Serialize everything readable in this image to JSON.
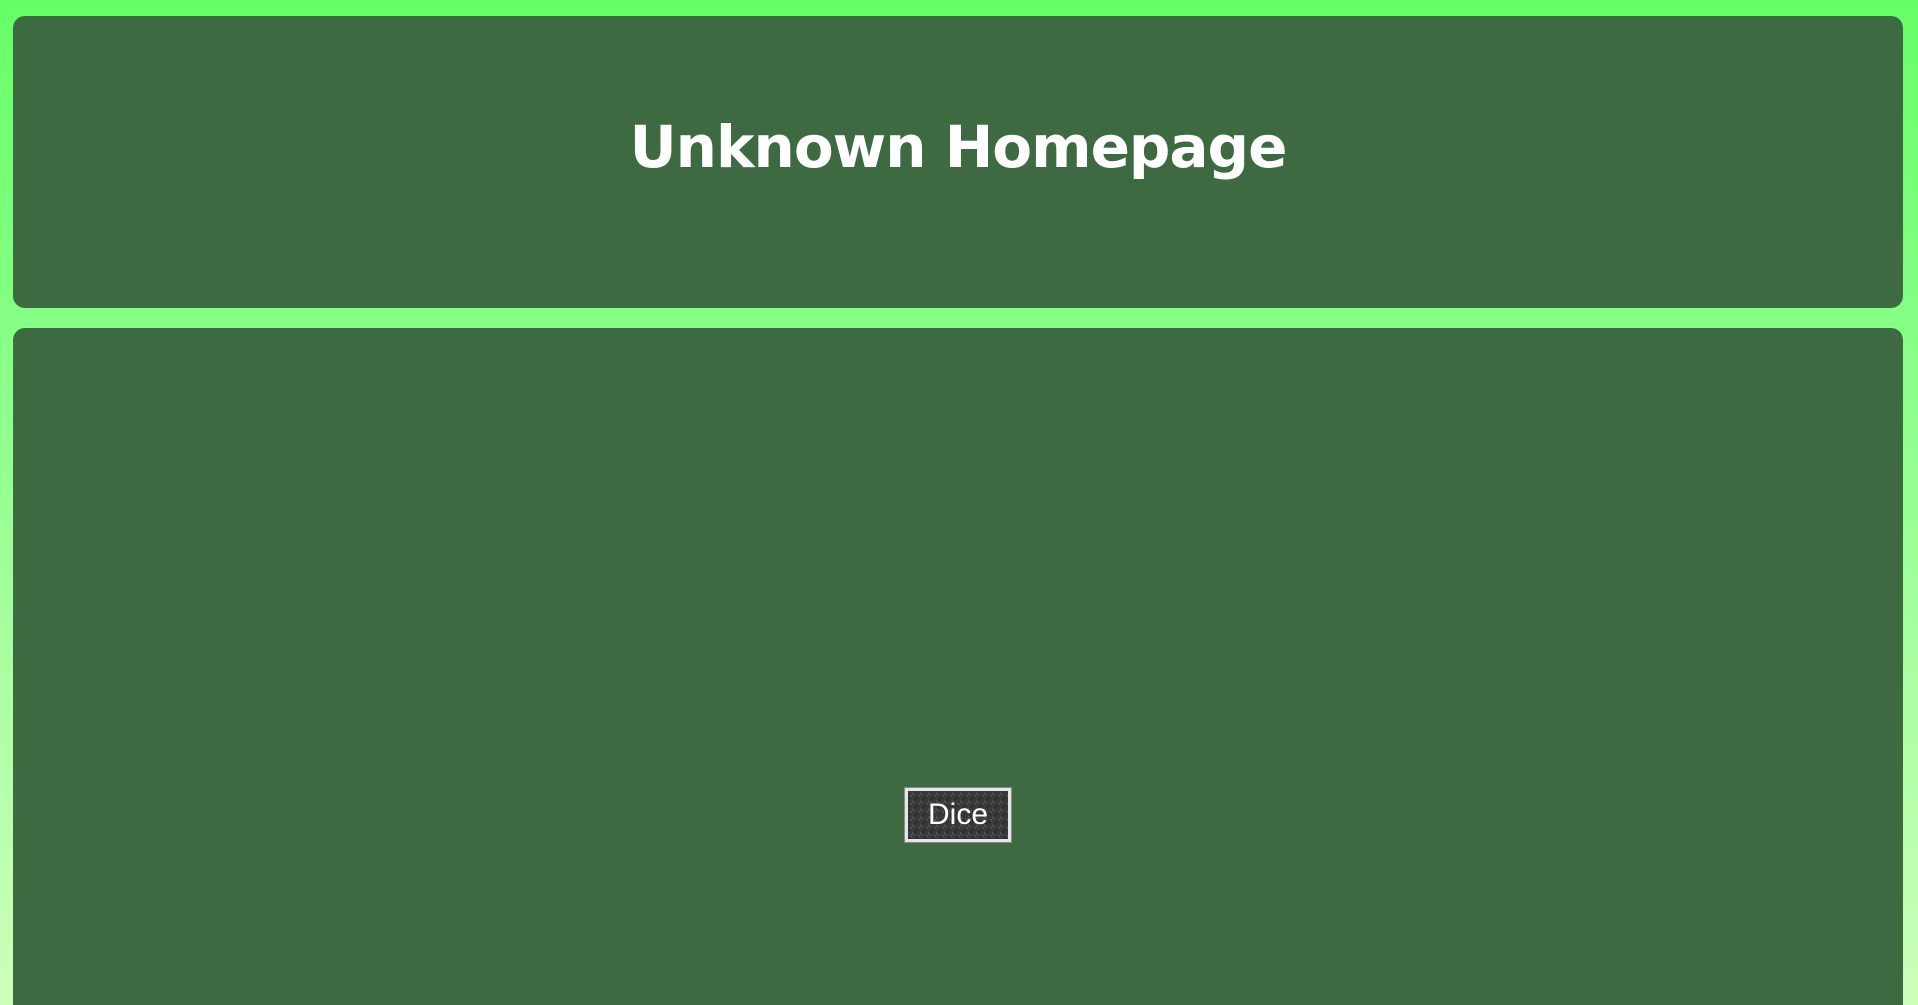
{
  "header": {
    "title": "Unknown Homepage"
  },
  "main": {
    "dice_button_label": "Dice"
  },
  "colors": {
    "background_top": "#66ff66",
    "background_bottom": "#ccffbb",
    "panel": "#3e6a42",
    "text": "#ffffff"
  }
}
